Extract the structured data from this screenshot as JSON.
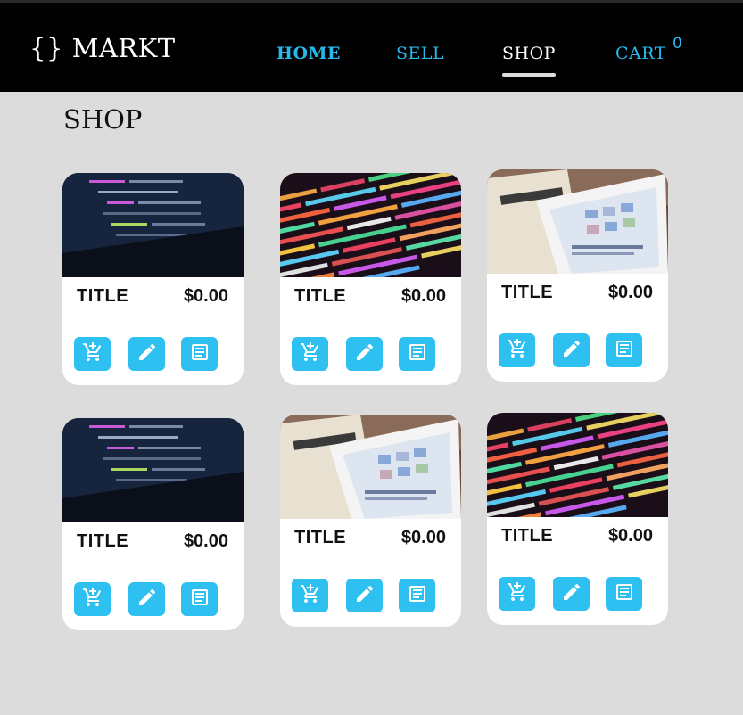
{
  "header": {
    "logo": "{} MARKT",
    "nav": [
      {
        "label": "HOME"
      },
      {
        "label": "SELL"
      },
      {
        "label": "SHOP"
      },
      {
        "label": "CART"
      }
    ],
    "cart_count": "0"
  },
  "page": {
    "title": "SHOP"
  },
  "products": [
    {
      "title": "TITLE",
      "price": "$0.00",
      "image": "laptop-code"
    },
    {
      "title": "TITLE",
      "price": "$0.00",
      "image": "colorful-code"
    },
    {
      "title": "TITLE",
      "price": "$0.00",
      "image": "tablet-newspaper"
    },
    {
      "title": "TITLE",
      "price": "$0.00",
      "image": "laptop-code"
    },
    {
      "title": "TITLE",
      "price": "$0.00",
      "image": "tablet-newspaper"
    },
    {
      "title": "TITLE",
      "price": "$0.00",
      "image": "colorful-code"
    }
  ],
  "icons": {
    "add_to_cart": "add-cart-icon",
    "edit": "pencil-icon",
    "details": "document-icon"
  },
  "colors": {
    "accent": "#29b8ec",
    "button": "#2ec0f0",
    "header_bg": "#000000",
    "page_bg": "#dcdcdc"
  }
}
